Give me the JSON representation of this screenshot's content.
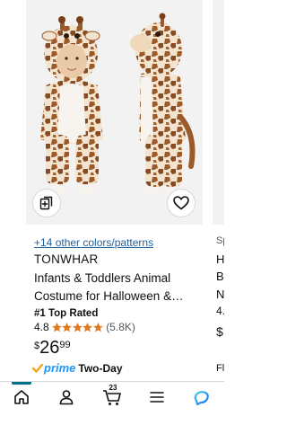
{
  "product": {
    "more_colors": "+14 other colors/patterns",
    "brand": "TONWHAR",
    "title": "Infants & Toddlers Animal Costume for Halloween &…",
    "badge": "#1 Top Rated",
    "rating": "4.8",
    "stars_value": 4.8,
    "stars_max": 5,
    "reviews": "(5.8K)",
    "price_currency": "$",
    "price_whole": "26",
    "price_fraction": "99",
    "prime_label": "prime",
    "delivery": "Two-Day",
    "image_icon": "giraffe-costume-photo"
  },
  "next_product": {
    "sponsored": "Sp",
    "line1": "H",
    "line2": "B",
    "line3": "N",
    "rating": "4.",
    "price": "$",
    "delivery": "Fl"
  },
  "nav": {
    "cart_count": "23",
    "items": [
      "home-icon",
      "account-icon",
      "cart-icon",
      "menu-icon",
      "rufus-icon"
    ]
  },
  "colors": {
    "prime_blue": "#1a98ff",
    "link_blue": "#2162a1",
    "star_orange": "#de7921",
    "nav_accent": "#007185"
  }
}
